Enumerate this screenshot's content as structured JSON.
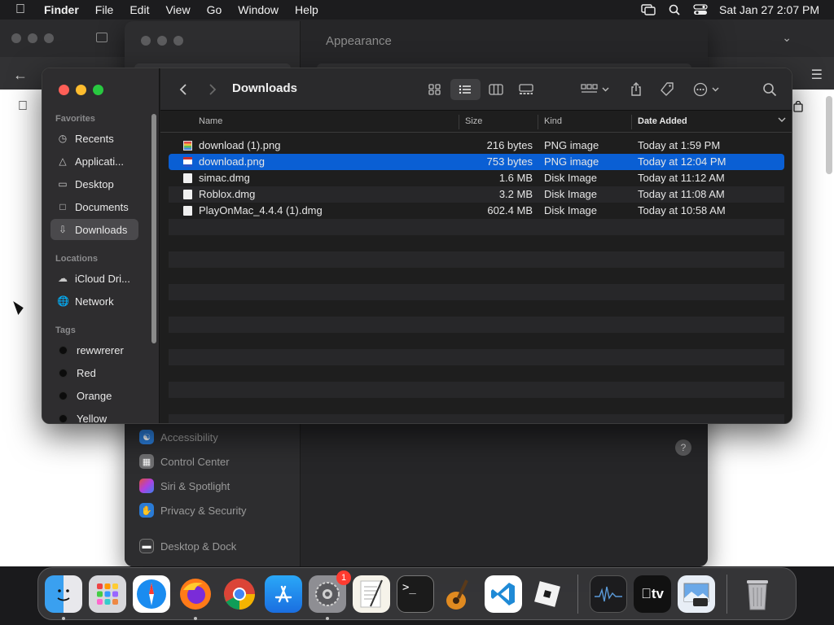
{
  "menubar": {
    "app_name": "Finder",
    "items": [
      "File",
      "Edit",
      "View",
      "Go",
      "Window",
      "Help"
    ],
    "datetime": "Sat Jan 27  2:07 PM"
  },
  "settings_window": {
    "title": "Appearance",
    "sidebar_items": [
      {
        "label": "Accessibility",
        "icon": "accessibility-icon",
        "color": "#2a7bd6"
      },
      {
        "label": "Control Center",
        "icon": "control-center-icon",
        "color": "#707072"
      },
      {
        "label": "Siri & Spotlight",
        "icon": "siri-icon",
        "color": "#c850c0"
      },
      {
        "label": "Privacy & Security",
        "icon": "hand-icon",
        "color": "#2a7bd6"
      },
      {
        "label": "Desktop & Dock",
        "icon": "desktop-dock-icon",
        "color": "#3a3a3c"
      }
    ],
    "help_label": "?"
  },
  "finder": {
    "title": "Downloads",
    "sidebar": {
      "favorites_header": "Favorites",
      "favorites": [
        {
          "label": "Recents",
          "icon": "clock-icon",
          "active": false
        },
        {
          "label": "Applicati...",
          "icon": "applications-icon",
          "active": false
        },
        {
          "label": "Desktop",
          "icon": "desktop-icon",
          "active": false
        },
        {
          "label": "Documents",
          "icon": "document-icon",
          "active": false
        },
        {
          "label": "Downloads",
          "icon": "download-icon",
          "active": true
        }
      ],
      "locations_header": "Locations",
      "locations": [
        {
          "label": "iCloud Dri...",
          "icon": "cloud-icon"
        },
        {
          "label": "Network",
          "icon": "network-icon"
        }
      ],
      "tags_header": "Tags",
      "tags": [
        {
          "label": "rewwrerer"
        },
        {
          "label": "Red"
        },
        {
          "label": "Orange"
        },
        {
          "label": "Yellow"
        }
      ]
    },
    "columns": {
      "name": "Name",
      "size": "Size",
      "kind": "Kind",
      "date": "Date Added"
    },
    "files": [
      {
        "name": "download (1).png",
        "size": "216 bytes",
        "kind": "PNG image",
        "date": "Today at 1:59 PM",
        "icon": "png-icon",
        "selected": false
      },
      {
        "name": "download.png",
        "size": "753 bytes",
        "kind": "PNG image",
        "date": "Today at 12:04 PM",
        "icon": "png-icon",
        "selected": true
      },
      {
        "name": "simac.dmg",
        "size": "1.6 MB",
        "kind": "Disk Image",
        "date": "Today at 11:12 AM",
        "icon": "disk-image-icon",
        "selected": false
      },
      {
        "name": "Roblox.dmg",
        "size": "3.2 MB",
        "kind": "Disk Image",
        "date": "Today at 11:08 AM",
        "icon": "disk-image-icon",
        "selected": false
      },
      {
        "name": "PlayOnMac_4.4.4 (1).dmg",
        "size": "602.4 MB",
        "kind": "Disk Image",
        "date": "Today at 10:58 AM",
        "icon": "disk-image-icon",
        "selected": false
      }
    ],
    "selection_color": "#0a5fd4"
  },
  "dock": {
    "apps": [
      {
        "name": "Finder",
        "icon": "finder-icon",
        "running": true
      },
      {
        "name": "Launchpad",
        "icon": "launchpad-icon",
        "running": false
      },
      {
        "name": "Safari",
        "icon": "safari-icon",
        "running": false
      },
      {
        "name": "Firefox",
        "icon": "firefox-icon",
        "running": true
      },
      {
        "name": "Chrome",
        "icon": "chrome-icon",
        "running": false
      },
      {
        "name": "App Store",
        "icon": "app-store-icon",
        "running": false
      },
      {
        "name": "System Settings",
        "icon": "settings-icon",
        "running": true,
        "badge": "1"
      },
      {
        "name": "TextEdit",
        "icon": "textedit-icon",
        "running": false
      },
      {
        "name": "Terminal",
        "icon": "terminal-icon",
        "running": false
      },
      {
        "name": "GarageBand",
        "icon": "garageband-icon",
        "running": false
      },
      {
        "name": "VS Code",
        "icon": "vscode-icon",
        "running": false
      },
      {
        "name": "Roblox",
        "icon": "roblox-icon",
        "running": false
      },
      {
        "name": "Activity Monitor",
        "icon": "activity-monitor-icon",
        "running": false
      },
      {
        "name": "Apple TV",
        "icon": "apple-tv-icon",
        "running": false
      },
      {
        "name": "Preview",
        "icon": "preview-icon",
        "running": false
      },
      {
        "name": "Trash",
        "icon": "trash-icon",
        "running": false
      }
    ],
    "tv_label": "tv",
    "terminal_label": ">_"
  }
}
